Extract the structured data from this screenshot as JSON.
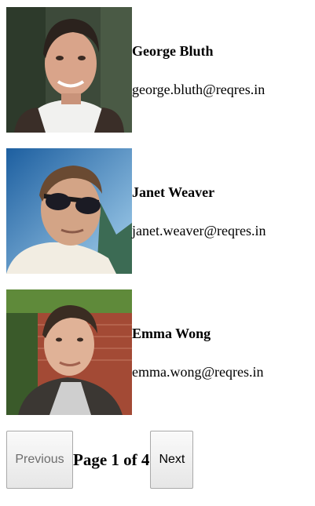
{
  "users": [
    {
      "name": "George Bluth",
      "email": "george.bluth@reqres.in"
    },
    {
      "name": "Janet Weaver",
      "email": "janet.weaver@reqres.in"
    },
    {
      "name": "Emma Wong",
      "email": "emma.wong@reqres.in"
    }
  ],
  "pagination": {
    "previous_label": "Previous",
    "page_text": "Page 1 of 4",
    "next_label": "Next"
  },
  "colors": {
    "button_border": "#a9a9a9",
    "disabled_text": "#6d6d6d"
  }
}
